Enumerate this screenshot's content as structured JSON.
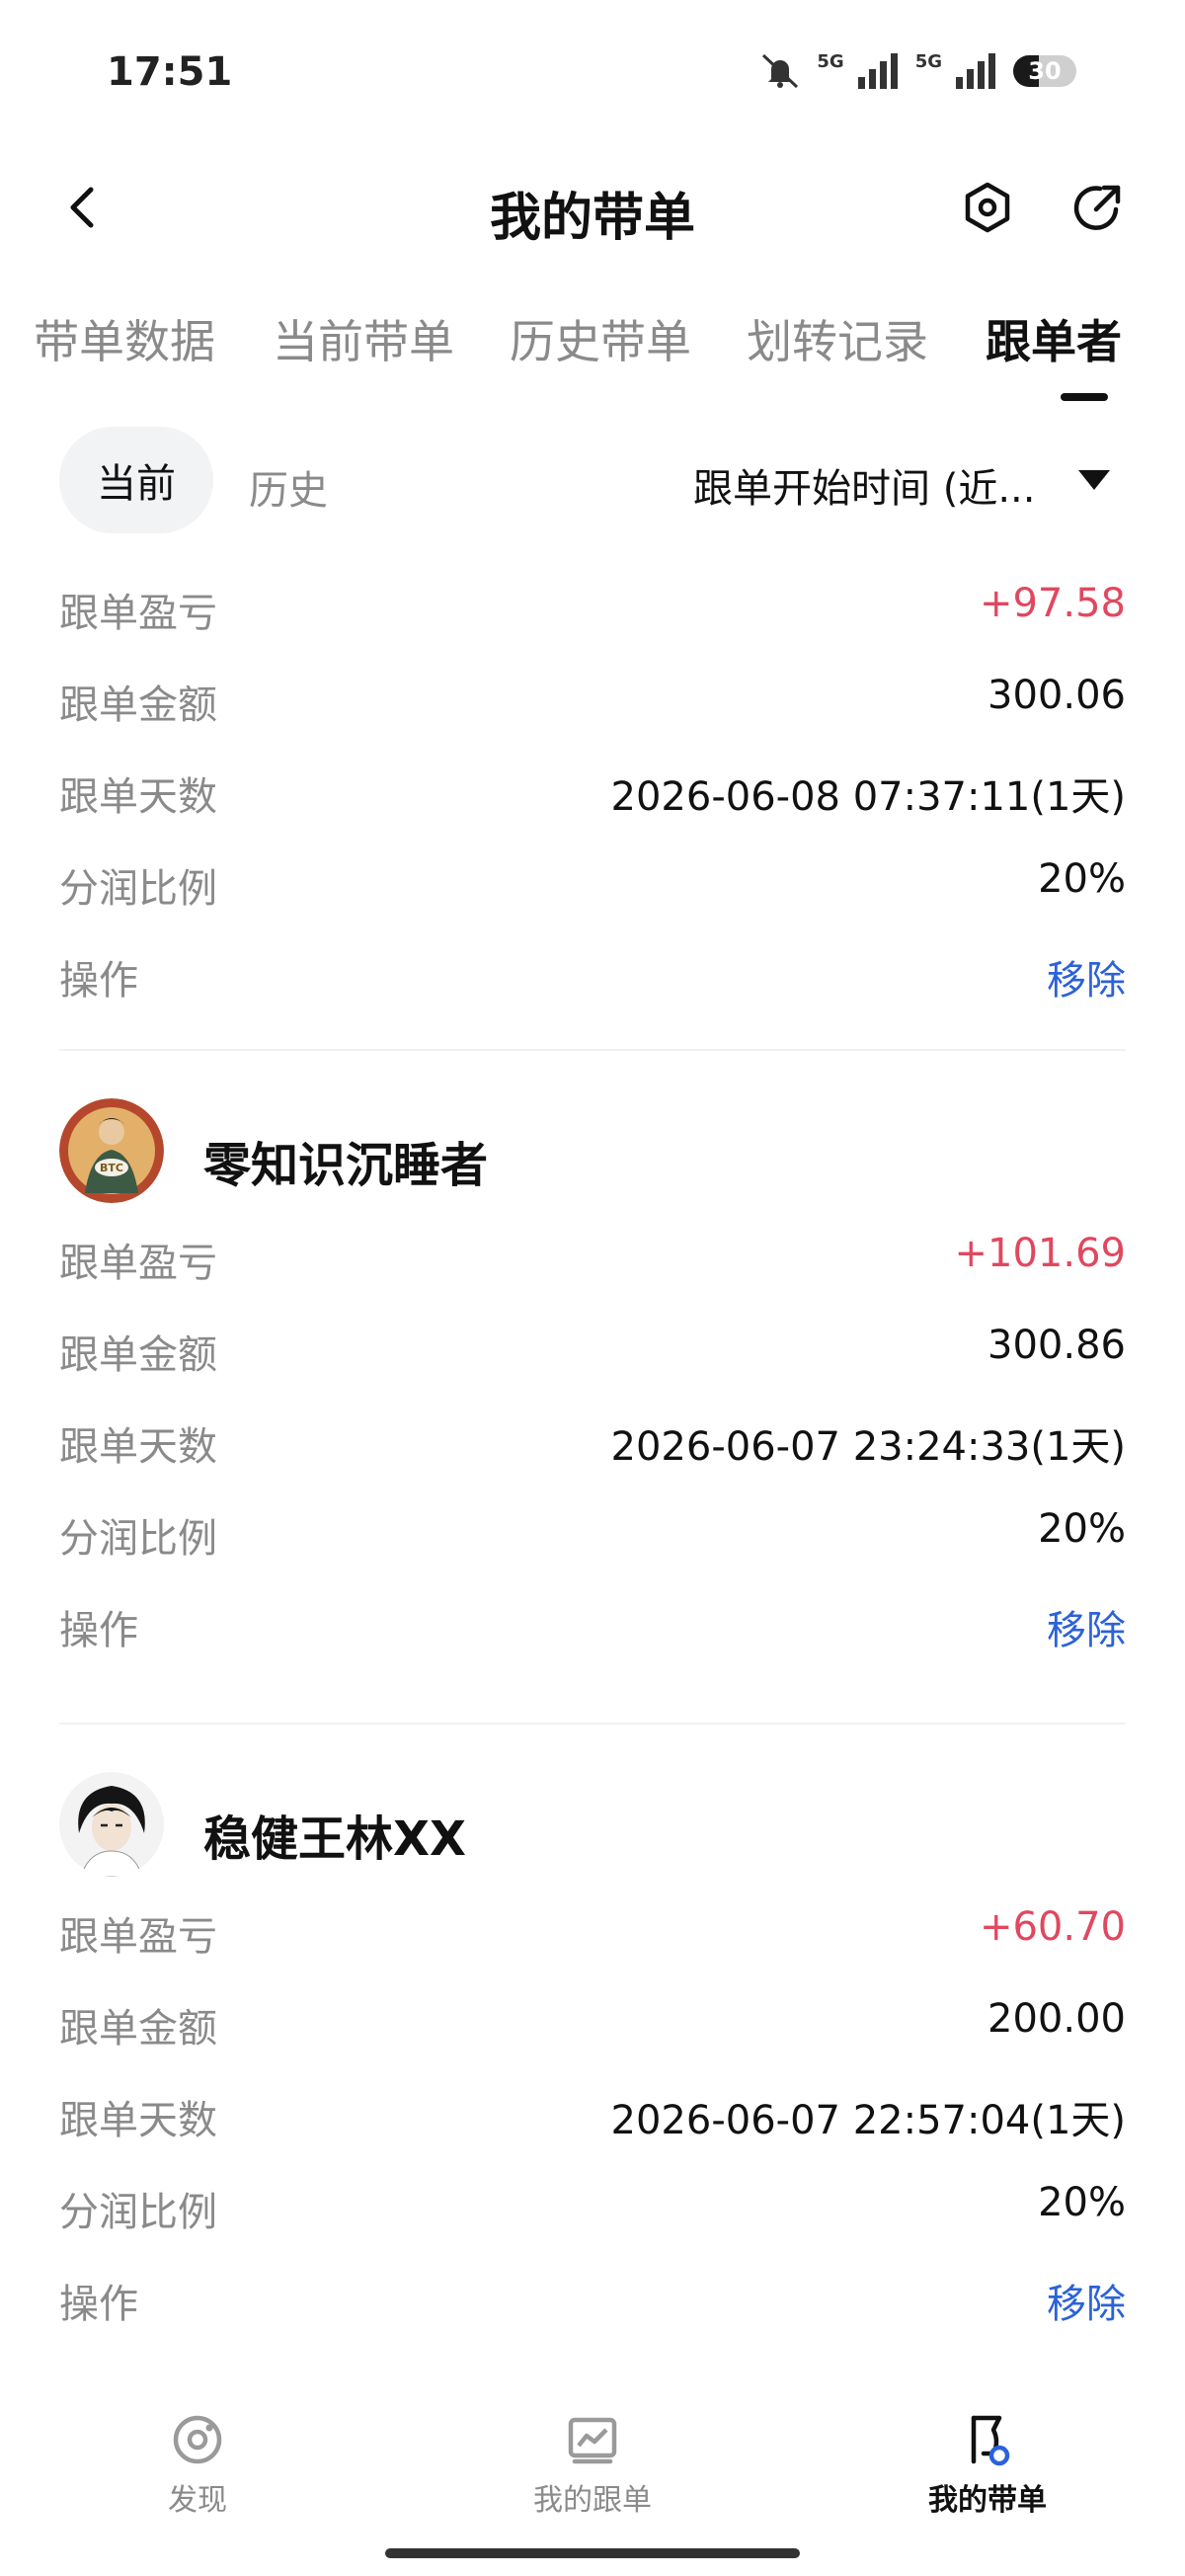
{
  "status_bar": {
    "time": "17:51",
    "network_1": "5G",
    "network_2": "5G",
    "battery": "30"
  },
  "header": {
    "title": "我的带单"
  },
  "tabs": [
    {
      "label": "带单数据"
    },
    {
      "label": "当前带单"
    },
    {
      "label": "历史带单"
    },
    {
      "label": "划转记录"
    },
    {
      "label": "跟单者"
    }
  ],
  "filter": {
    "current": "当前",
    "history": "历史",
    "sort": "跟单开始时间 (近..."
  },
  "followers": [
    {
      "name": "",
      "rows": [
        {
          "label": "跟单盈亏",
          "value": "+97.58"
        },
        {
          "label": "跟单金额",
          "value": "300.06"
        },
        {
          "label": "跟单天数",
          "value": "2026-06-08 07:37:11(1天)"
        },
        {
          "label": "分润比例",
          "value": "20%"
        },
        {
          "label": "操作",
          "value": "移除"
        }
      ]
    },
    {
      "name": "零知识沉睡者",
      "avatar_text": "BTC",
      "rows": [
        {
          "label": "跟单盈亏",
          "value": "+101.69"
        },
        {
          "label": "跟单金额",
          "value": "300.86"
        },
        {
          "label": "跟单天数",
          "value": "2026-06-07 23:24:33(1天)"
        },
        {
          "label": "分润比例",
          "value": "20%"
        },
        {
          "label": "操作",
          "value": "移除"
        }
      ]
    },
    {
      "name": "稳健王林XX",
      "rows": [
        {
          "label": "跟单盈亏",
          "value": "+60.70"
        },
        {
          "label": "跟单金额",
          "value": "200.00"
        },
        {
          "label": "跟单天数",
          "value": "2026-06-07 22:57:04(1天)"
        },
        {
          "label": "分润比例",
          "value": "20%"
        },
        {
          "label": "操作",
          "value": "移除"
        }
      ]
    }
  ],
  "bottom_nav": [
    {
      "label": "发现",
      "icon": "discover-icon"
    },
    {
      "label": "我的跟单",
      "icon": "chart-icon"
    },
    {
      "label": "我的带单",
      "icon": "flag-icon",
      "active": true
    }
  ],
  "colors": {
    "profit": "#e0485f",
    "link": "#2b62d9",
    "muted": "#8a8a8a"
  }
}
